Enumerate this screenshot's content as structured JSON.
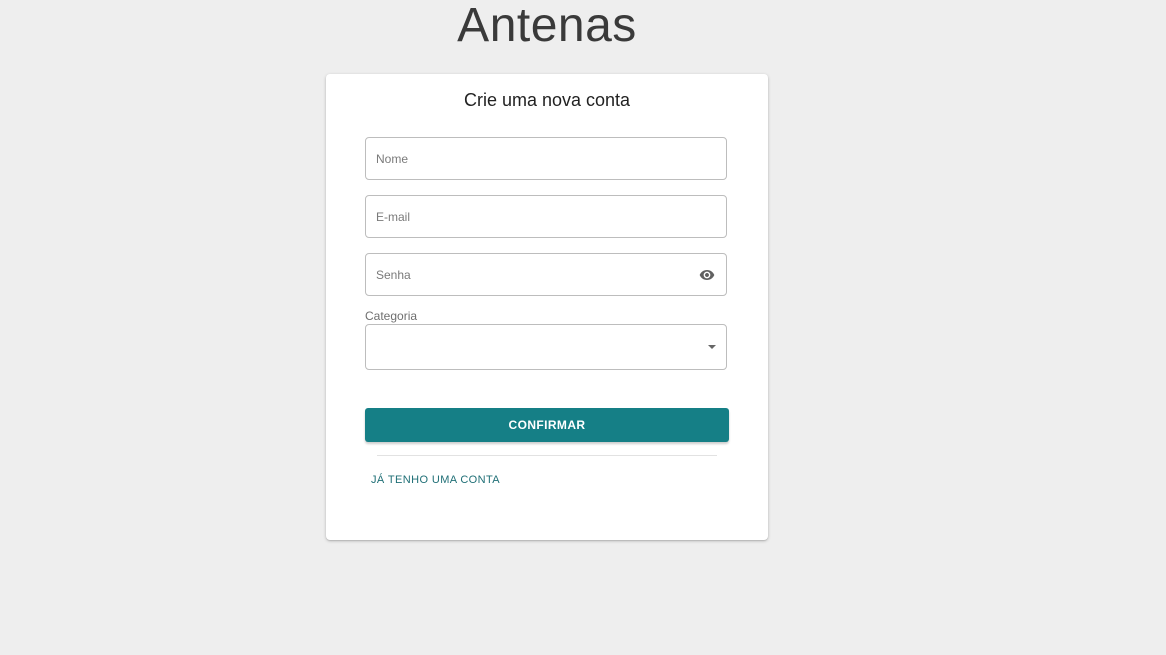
{
  "app": {
    "title": "Antenas"
  },
  "form": {
    "title": "Crie uma nova conta",
    "fields": {
      "nome": {
        "placeholder": "Nome",
        "value": ""
      },
      "email": {
        "placeholder": "E-mail",
        "value": ""
      },
      "senha": {
        "placeholder": "Senha",
        "value": "",
        "toggle_icon": "eye-icon"
      }
    },
    "categoria": {
      "label": "Categoria",
      "selected": "",
      "icon": "caret-down-icon"
    },
    "confirm_label": "CONFIRMAR",
    "login_link": "JÁ TENHO UMA CONTA"
  },
  "colors": {
    "background": "#eeeeee",
    "card": "#ffffff",
    "accent": "#157f86",
    "link": "#1f6f76"
  }
}
